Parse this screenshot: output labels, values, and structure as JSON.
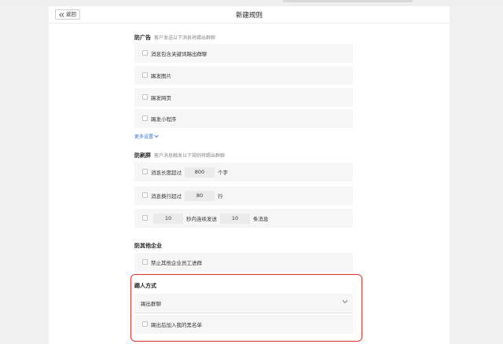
{
  "header": {
    "back_label": "返回",
    "title": "新建规则"
  },
  "anti_ads": {
    "title": "防广告",
    "subtitle": "客户发送以下消息将踢出群聊",
    "options": [
      "消息包含关键词踢出群聊",
      "踢发图片",
      "踢发网页",
      "踢发小程序"
    ],
    "more_label": "更多设置"
  },
  "anti_flood": {
    "title": "防刷屏",
    "subtitle": "客户消息触发以下规则将踢出群聊",
    "length": {
      "label": "消息长度超过",
      "value": "800",
      "unit": "个字"
    },
    "lines": {
      "label": "消息换行超过",
      "value": "80",
      "unit": "行"
    },
    "rate": {
      "seconds": "10",
      "middle": "秒内连续发送",
      "count": "10",
      "unit": "条消息"
    }
  },
  "anti_other": {
    "title": "防其他企业",
    "option": "禁止其他企业员工进群"
  },
  "kick_method": {
    "title": "踢人方式",
    "selected": "踢出群聊",
    "blacklist_option": "踢出后加入我的黑名单"
  },
  "colors": {
    "highlight": "#d9302a",
    "link": "#3a6fd8"
  }
}
